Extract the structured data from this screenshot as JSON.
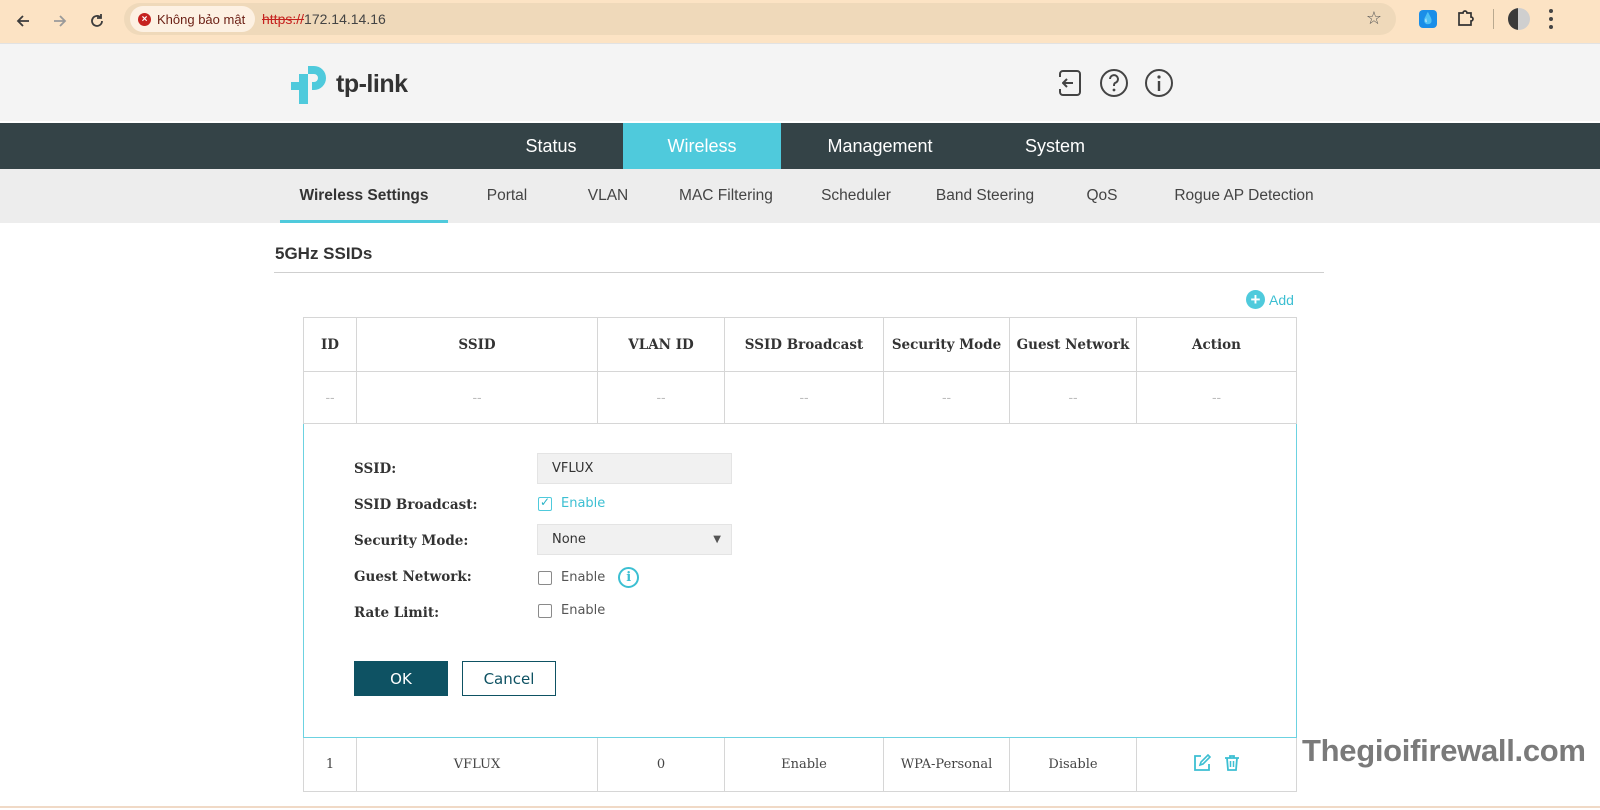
{
  "browser": {
    "security_label": "Không bảo mật",
    "url_scheme": "https://",
    "url_host": "172.14.14.16"
  },
  "header": {
    "logo_text": "tp-link",
    "icons": [
      "logout-icon",
      "help-icon",
      "about-icon"
    ]
  },
  "main_nav": [
    {
      "label": "Status",
      "active": false
    },
    {
      "label": "Wireless",
      "active": true
    },
    {
      "label": "Management",
      "active": false
    },
    {
      "label": "System",
      "active": false
    }
  ],
  "sub_nav": [
    {
      "label": "Wireless Settings",
      "active": true
    },
    {
      "label": "Portal"
    },
    {
      "label": "VLAN"
    },
    {
      "label": "MAC Filtering"
    },
    {
      "label": "Scheduler"
    },
    {
      "label": "Band Steering"
    },
    {
      "label": "QoS"
    },
    {
      "label": "Rogue AP Detection"
    }
  ],
  "section": {
    "title": "5GHz SSIDs",
    "add_label": "Add"
  },
  "table": {
    "columns": [
      "ID",
      "SSID",
      "VLAN ID",
      "SSID Broadcast",
      "Security Mode",
      "Guest Network",
      "Action"
    ],
    "placeholder": [
      "--",
      "--",
      "--",
      "--",
      "--",
      "--",
      "--"
    ],
    "rows": [
      {
        "id": "1",
        "ssid": "VFLUX",
        "vlan_id": "0",
        "broadcast": "Enable",
        "security": "WPA-Personal",
        "guest": "Disable"
      }
    ]
  },
  "form": {
    "ssid_label": "SSID:",
    "ssid_value": "VFLUX",
    "broadcast_label": "SSID Broadcast:",
    "broadcast_option": "Enable",
    "broadcast_checked": true,
    "security_label": "Security Mode:",
    "security_value": "None",
    "guest_label": "Guest Network:",
    "guest_option": "Enable",
    "guest_checked": false,
    "rate_label": "Rate Limit:",
    "rate_option": "Enable",
    "rate_checked": false,
    "ok_label": "OK",
    "cancel_label": "Cancel"
  },
  "watermark": "Thegioifirewall.com",
  "colors": {
    "accent": "#4fcadc",
    "nav_bg": "#344347",
    "primary_button": "#0e5263"
  }
}
